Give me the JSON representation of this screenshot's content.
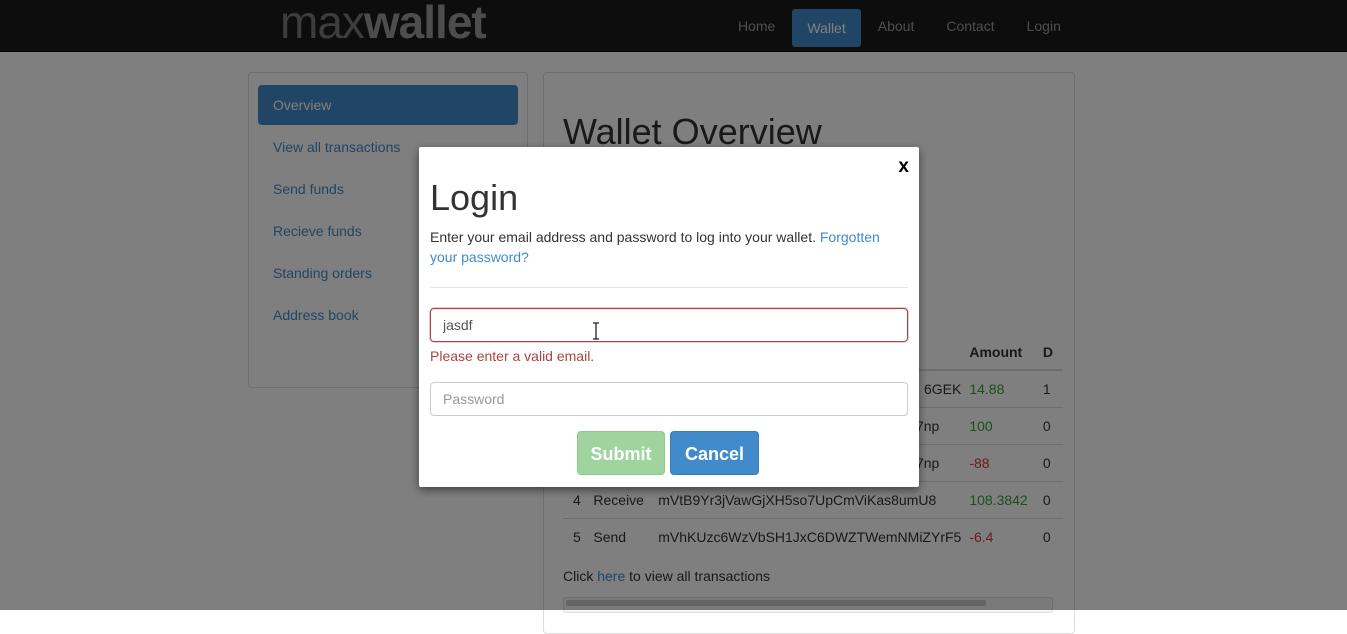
{
  "brand": {
    "light": "max",
    "bold": "wallet"
  },
  "nav": [
    {
      "label": "Home",
      "active": false
    },
    {
      "label": "Wallet",
      "active": true
    },
    {
      "label": "About",
      "active": false
    },
    {
      "label": "Contact",
      "active": false
    },
    {
      "label": "Login",
      "active": false
    }
  ],
  "sidebar": {
    "items": [
      {
        "label": "Overview",
        "active": true
      },
      {
        "label": "View all transactions",
        "active": false
      },
      {
        "label": "Send funds",
        "active": false
      },
      {
        "label": "Recieve funds",
        "active": false
      },
      {
        "label": "Standing orders",
        "active": false
      },
      {
        "label": "Address book",
        "active": false
      }
    ]
  },
  "main": {
    "title": "Wallet Overview",
    "table": {
      "headers": {
        "amount": "Amount",
        "extra": "D"
      },
      "rows": [
        {
          "num": "",
          "type": "",
          "address": "6GEK",
          "amount": "14.88",
          "extra": "1",
          "sign": "pos"
        },
        {
          "num": "",
          "type": "",
          "address": "7np",
          "amount": "100",
          "extra": "0",
          "sign": "pos"
        },
        {
          "num": "",
          "type": "",
          "address": "7np",
          "amount": "-88",
          "extra": "0",
          "sign": "neg"
        },
        {
          "num": "4",
          "type": "Receive",
          "address": "mVtB9Yr3jVawGjXH5so7UpCmViKas8umU8",
          "amount": "108.3842",
          "extra": "0",
          "sign": "pos"
        },
        {
          "num": "5",
          "type": "Send",
          "address": "mVhKUzc6WzVbSH1JxC6DWZTWemNMiZYrF5",
          "amount": "-6.4",
          "extra": "0",
          "sign": "neg"
        }
      ]
    },
    "more_prefix": "Click",
    "more_link": "here",
    "more_suffix": "to view all transactions"
  },
  "modal": {
    "close": "x",
    "title": "Login",
    "desc": "Enter your email address and password to log into your wallet.",
    "forgot_link": "Forgotten your password?",
    "email_value": "jasdf",
    "email_error": "Please enter a valid email.",
    "password_placeholder": "Password",
    "submit_label": "Submit",
    "cancel_label": "Cancel"
  },
  "colors": {
    "primary": "#428bca",
    "success_disabled": "#9fd49f",
    "error": "#a94442"
  }
}
